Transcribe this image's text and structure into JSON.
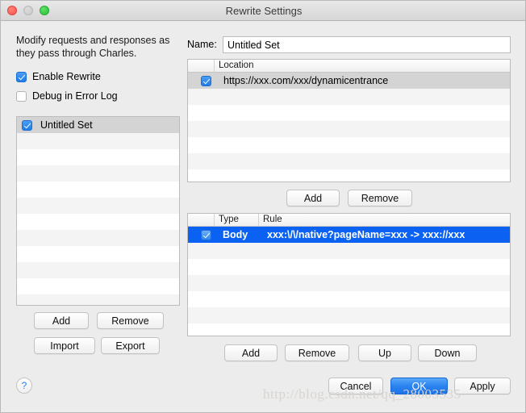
{
  "window": {
    "title": "Rewrite Settings",
    "traffic_lights": [
      "close",
      "minimize",
      "zoom"
    ]
  },
  "left": {
    "description": "Modify requests and responses as they pass through Charles.",
    "checkboxes": [
      {
        "label": "Enable Rewrite",
        "checked": true
      },
      {
        "label": "Debug in Error Log",
        "checked": false
      }
    ],
    "sets": [
      {
        "label": "Untitled Set",
        "checked": true,
        "selected": true
      }
    ],
    "buttons": {
      "add": "Add",
      "remove": "Remove",
      "import": "Import",
      "export": "Export"
    },
    "help": "?"
  },
  "right": {
    "name_label": "Name:",
    "name_value": "Untitled Set",
    "locations": {
      "columns": [
        "",
        "Location"
      ],
      "rows": [
        {
          "checked": true,
          "location": "https://xxx.com/xxx/dynamicentrance",
          "selected": true
        }
      ],
      "buttons": {
        "add": "Add",
        "remove": "Remove"
      }
    },
    "rules": {
      "columns": [
        "",
        "Type",
        "Rule"
      ],
      "rows": [
        {
          "checked": true,
          "type": "Body",
          "rule": "xxx:\\/\\/native?pageName=xxx -> xxx://xxx",
          "selected": true
        }
      ],
      "buttons": {
        "add": "Add",
        "remove": "Remove",
        "up": "Up",
        "down": "Down"
      }
    }
  },
  "footer": {
    "cancel": "Cancel",
    "ok": "OK",
    "apply": "Apply"
  },
  "watermark": "http://blog.csdn.net/qq_28003535",
  "colors": {
    "accent": "#1c73e8",
    "selection_blue": "#0b62f2",
    "selection_gray": "#d4d4d4",
    "window_bg": "#ececec"
  }
}
